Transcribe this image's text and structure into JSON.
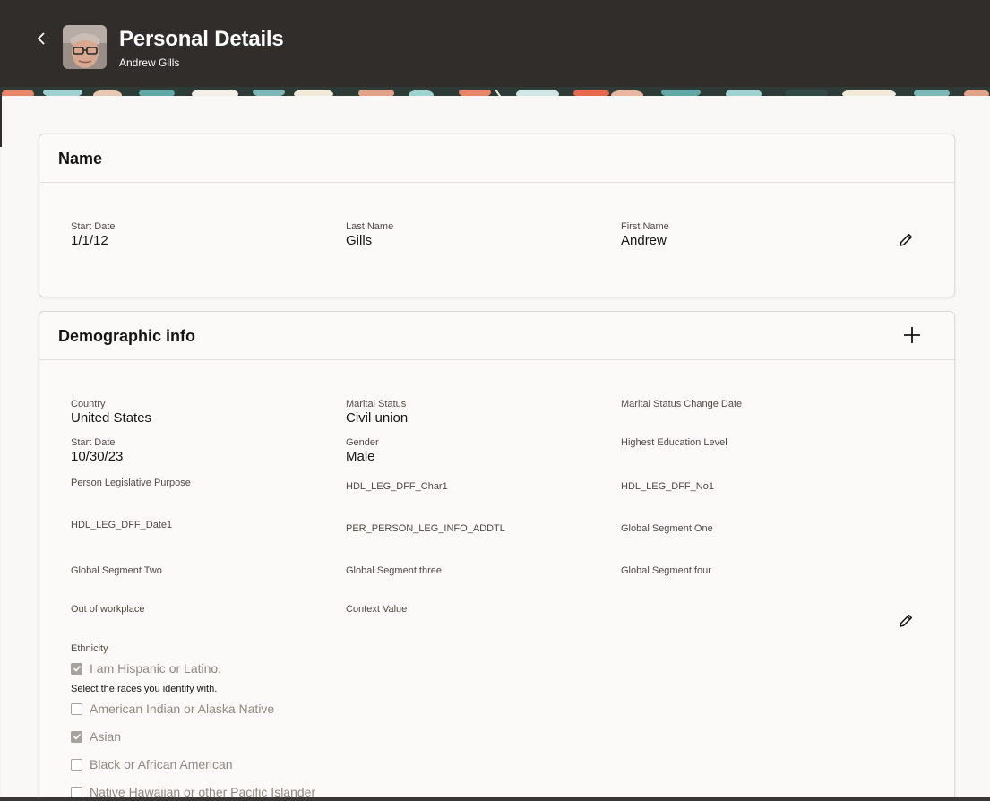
{
  "header": {
    "title": "Personal Details",
    "subtitle": "Andrew Gills",
    "back_icon": "chevron-left-icon",
    "background": "#312d2a"
  },
  "name_section": {
    "title": "Name",
    "fields": [
      {
        "label": "Start Date",
        "value": "1/1/12"
      },
      {
        "label": "Last Name",
        "value": "Gills"
      },
      {
        "label": "First Name",
        "value": "Andrew"
      }
    ],
    "edit_icon": "pencil-icon"
  },
  "demographic_section": {
    "title": "Demographic info",
    "add_icon": "plus-icon",
    "edit_icon": "pencil-icon",
    "fields": [
      {
        "label": "Country",
        "value": "United States"
      },
      {
        "label": "Marital Status",
        "value": "Civil union"
      },
      {
        "label": "Marital Status Change Date",
        "value": ""
      },
      {
        "label": "Start Date",
        "value": "10/30/23"
      },
      {
        "label": "Gender",
        "value": "Male"
      },
      {
        "label": "Highest Education Level",
        "value": ""
      },
      {
        "label": "Person Legislative Purpose",
        "value": ""
      },
      {
        "label": "HDL_LEG_DFF_Char1",
        "value": ""
      },
      {
        "label": "HDL_LEG_DFF_No1",
        "value": ""
      },
      {
        "label": "HDL_LEG_DFF_Date1",
        "value": ""
      },
      {
        "label": "PER_PERSON_LEG_INFO_ADDTL",
        "value": ""
      },
      {
        "label": "Global Segment One",
        "value": ""
      },
      {
        "label": "Global Segment Two",
        "value": ""
      },
      {
        "label": "Global Segment three",
        "value": ""
      },
      {
        "label": "Global Segment four",
        "value": ""
      },
      {
        "label": "Out of workplace",
        "value": ""
      },
      {
        "label": "Context Value",
        "value": ""
      }
    ],
    "ethnicity": {
      "label": "Ethnicity",
      "hispanic": {
        "label": "I am Hispanic or Latino.",
        "checked": true
      },
      "races_prompt": "Select the races you identify with.",
      "races": [
        {
          "label": "American Indian or Alaska Native",
          "checked": false
        },
        {
          "label": "Asian",
          "checked": true
        },
        {
          "label": "Black or African American",
          "checked": false
        },
        {
          "label": "Native Hawaiian or other Pacific Islander",
          "checked": false
        }
      ]
    }
  }
}
